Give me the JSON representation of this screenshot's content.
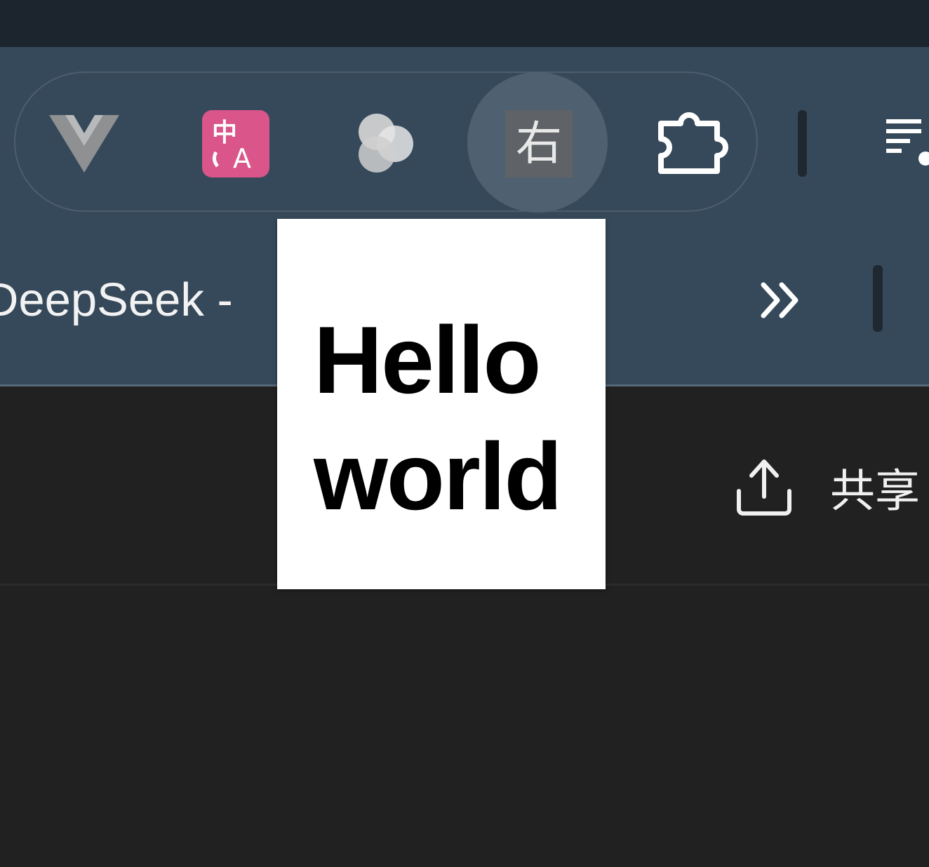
{
  "browser": {
    "extensions": [
      {
        "name": "vue-devtools",
        "icon": "vue-logo-icon"
      },
      {
        "name": "translate",
        "icon": "translate-icon",
        "color": "#d9558a"
      },
      {
        "name": "circles",
        "icon": "overlapping-circles-icon"
      },
      {
        "name": "kanji",
        "icon": "kanji-icon",
        "glyph": "右",
        "state": "hovered"
      },
      {
        "name": "extensions",
        "icon": "puzzle-icon"
      }
    ],
    "menu_icon": "reading-list-icon",
    "tab": {
      "title": "DeepSeek - "
    },
    "overflow_icon": "double-chevron-icon"
  },
  "page": {
    "share_label": "共享",
    "share_icon": "upload-icon"
  },
  "tooltip": {
    "text": "Hello\nworld"
  },
  "colors": {
    "titlebar": "#1c252d",
    "toolbar": "#35495a",
    "content": "#212121",
    "translate_badge": "#d9558a"
  }
}
